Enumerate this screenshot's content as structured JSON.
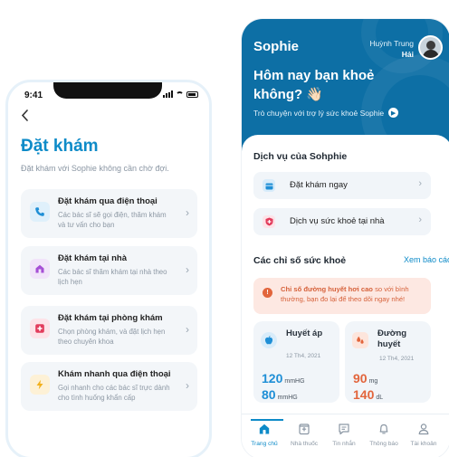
{
  "left_screen": {
    "status_time": "9:41",
    "back_icon": "chevron-left-icon",
    "title": "Đặt khám",
    "subtitle": "Đặt khám với Sophie không cần chờ đợi.",
    "options": [
      {
        "icon": "phone-icon",
        "color": "#1f8fd6",
        "bg": "#dff0fb",
        "title": "Đặt khám qua điện thoại",
        "desc": "Các bác sĩ sẽ gọi điện, thăm khám và tư vấn cho bạn"
      },
      {
        "icon": "home-icon",
        "color": "#a64fd6",
        "bg": "#f1e4fa",
        "title": "Đặt khám tại nhà",
        "desc": "Các bác sĩ thăm khám tại nhà theo lịch hẹn"
      },
      {
        "icon": "clinic-icon",
        "color": "#e23c5c",
        "bg": "#fde3e8",
        "title": "Đặt khám tại phòng khám",
        "desc": "Chọn phòng khám, và đặt lịch hẹn theo chuyên khoa"
      },
      {
        "icon": "lightning-icon",
        "color": "#f2b01b",
        "bg": "#fdf1d6",
        "title": "Khám nhanh qua điện thoại",
        "desc": "Gọi nhanh cho các bác sĩ trực dành cho tình huống khẩn cấp"
      }
    ]
  },
  "right_screen": {
    "brand": "Sophie",
    "user_first": "Huỳnh Trung",
    "user_last": "Hải",
    "greeting": "Hôm nay bạn khoẻ không? 👋🏻",
    "chat_link": "Trò chuyện với trợ lý sức khoẻ Sophie",
    "services_title": "Dịch vụ của Sohphie",
    "services": [
      {
        "icon": "calendar-icon",
        "color": "#1f8fd6",
        "bg": "#d8ecfa",
        "label": "Đặt khám ngay"
      },
      {
        "icon": "shield-plus-icon",
        "color": "#e23c5c",
        "bg": "#fde3e8",
        "label": "Dịch vụ sức khoẻ tại nhà"
      }
    ],
    "metrics_title": "Các chỉ số sức khoẻ",
    "report_link": "Xem báo cáo",
    "alert_bold": "Chỉ số đường huyết hơi cao",
    "alert_rest": " so với bình thường, bạn đo lại để theo dõi ngay nhé!",
    "metrics": [
      {
        "icon": "apple-icon",
        "color": "#1f8fd6",
        "bg": "#d8ecfa",
        "name": "Huyết áp",
        "date": "12 Th4, 2021",
        "val1": "120",
        "unit1": "mmHG",
        "val2": "80",
        "unit2": "mmHG",
        "val_color": "#1f8fd6"
      },
      {
        "icon": "blood-drop-icon",
        "color": "#e2653c",
        "bg": "#fde5dc",
        "name": "Đường huyết",
        "date": "12 Th4, 2021",
        "val1": "90",
        "unit1": "mg",
        "val2": "140",
        "unit2": "dL",
        "val_color": "#e2653c"
      }
    ],
    "tabs": [
      {
        "icon": "home-icon",
        "label": "Trang chủ",
        "active": true
      },
      {
        "icon": "pharmacy-icon",
        "label": "Nhà thuốc",
        "active": false
      },
      {
        "icon": "chat-icon",
        "label": "Tin nhắn",
        "active": false
      },
      {
        "icon": "bell-icon",
        "label": "Thông báo",
        "active": false
      },
      {
        "icon": "user-icon",
        "label": "Tài khoản",
        "active": false
      }
    ]
  }
}
